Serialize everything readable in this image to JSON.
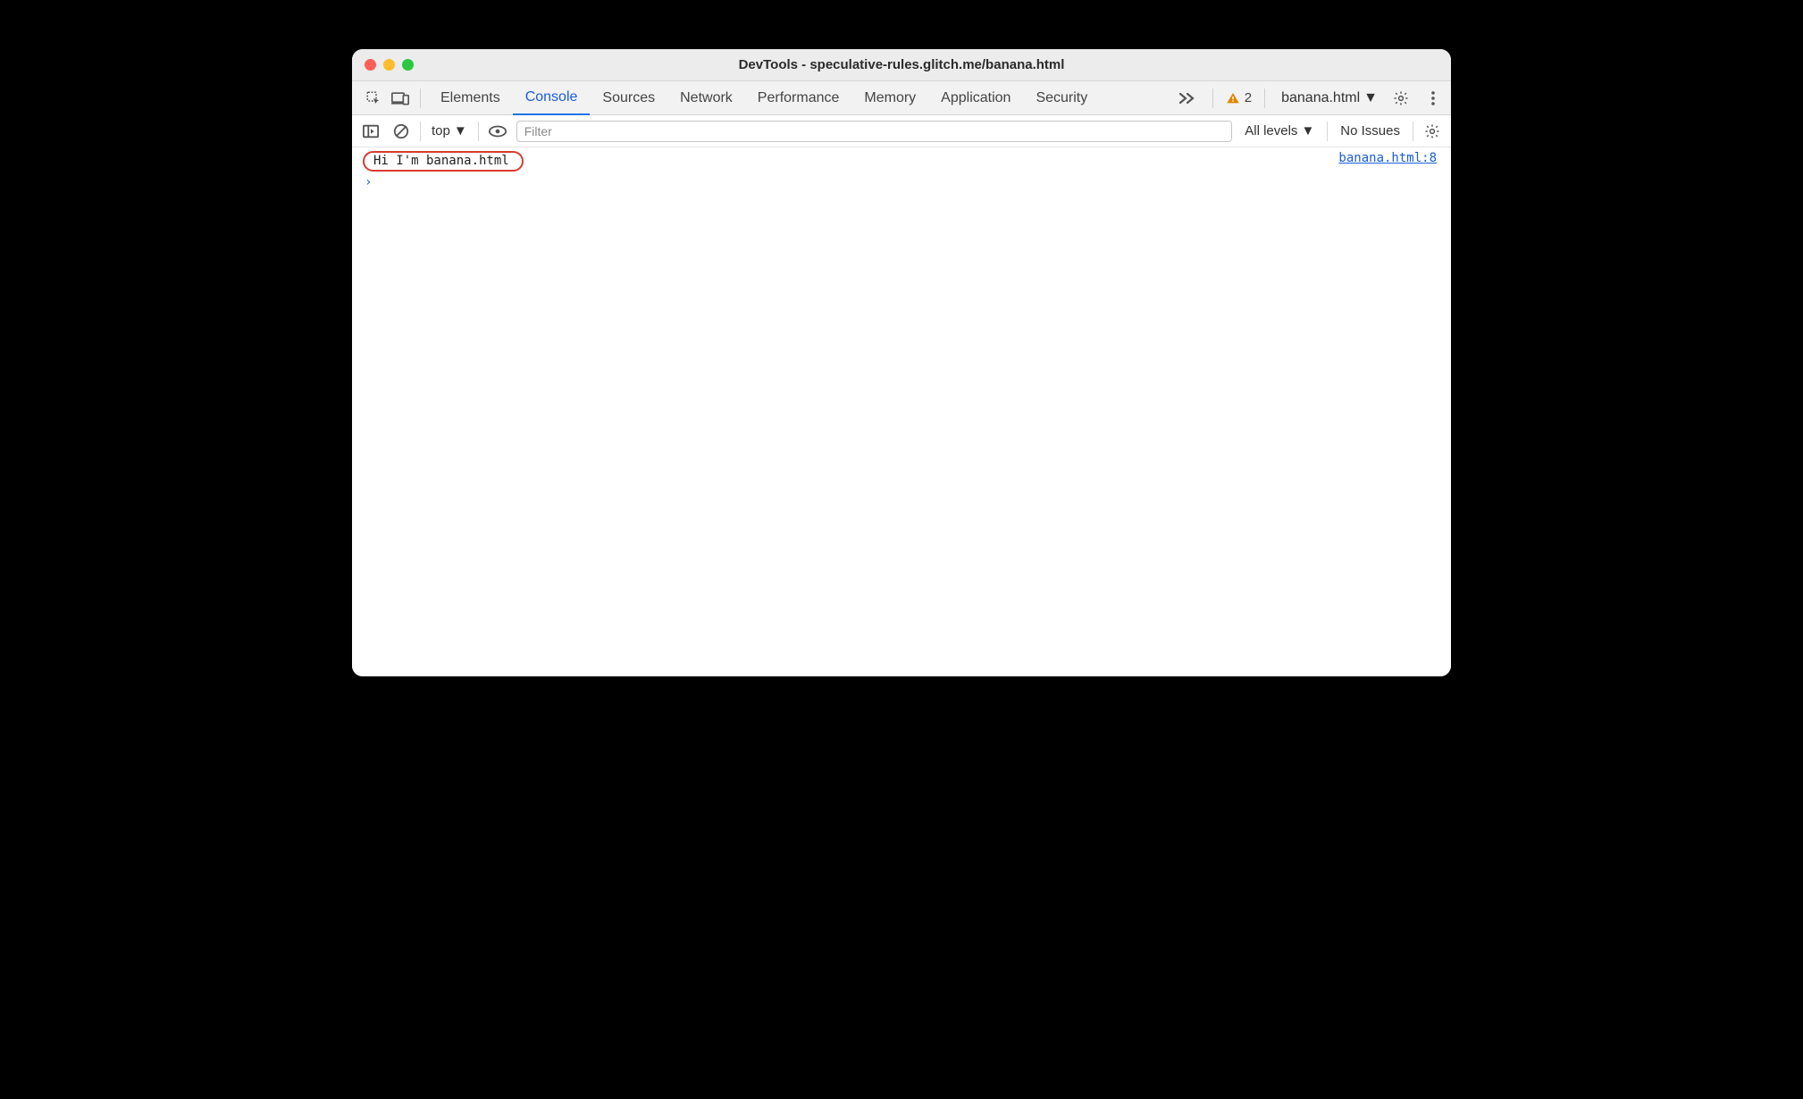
{
  "window": {
    "title": "DevTools - speculative-rules.glitch.me/banana.html"
  },
  "tabs": {
    "items": [
      "Elements",
      "Console",
      "Sources",
      "Network",
      "Performance",
      "Memory",
      "Application",
      "Security"
    ],
    "active": "Console"
  },
  "status": {
    "warning_count": "2",
    "frame_selector": "banana.html"
  },
  "console_toolbar": {
    "context": "top",
    "filter_placeholder": "Filter",
    "levels_label": "All levels",
    "issues_label": "No Issues"
  },
  "console": {
    "logs": [
      {
        "message": "Hi I'm banana.html",
        "source": "banana.html:8"
      }
    ],
    "prompt": "›"
  }
}
